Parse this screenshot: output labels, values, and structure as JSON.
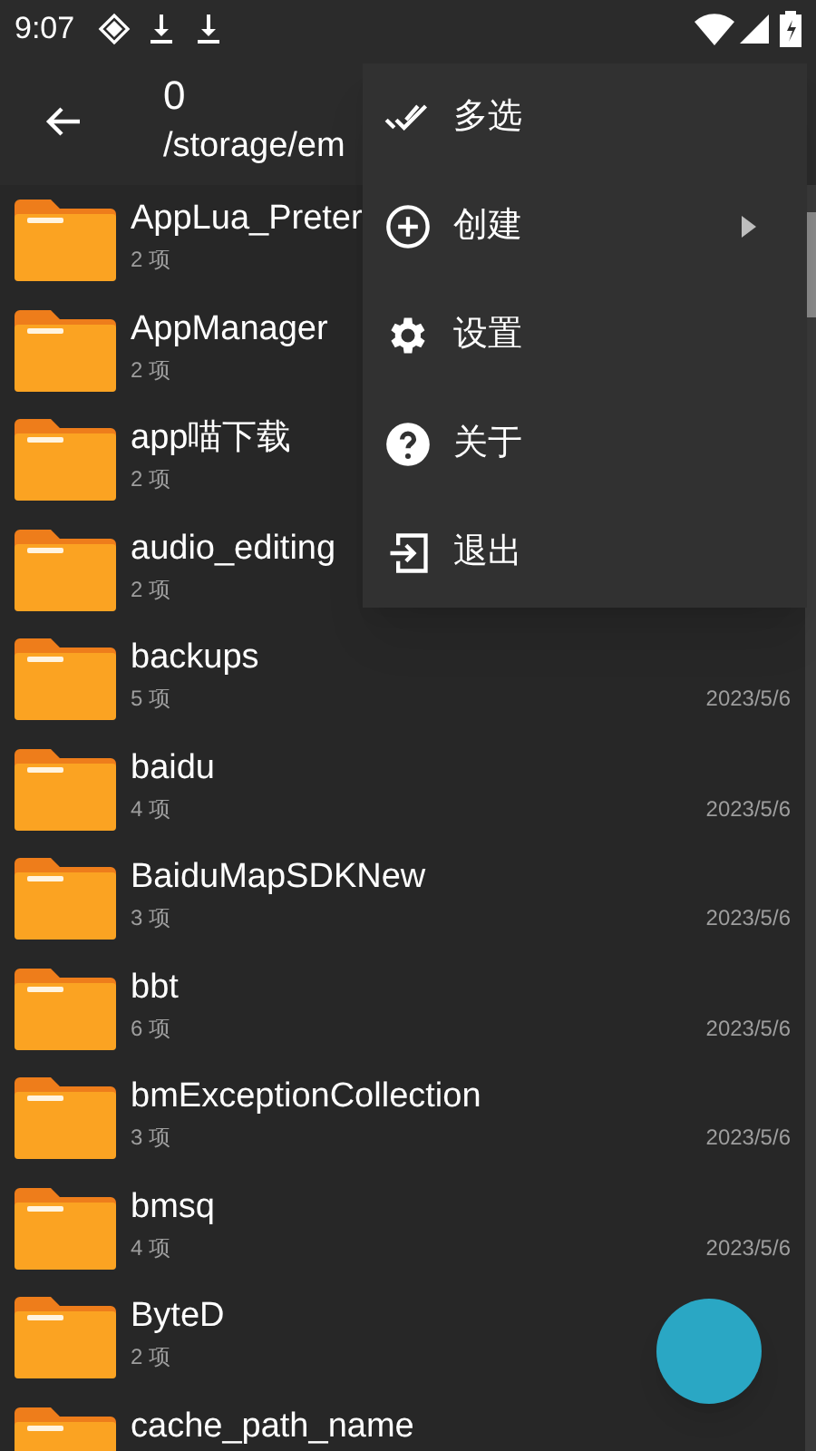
{
  "status_bar": {
    "time": "9:07"
  },
  "app_bar": {
    "title": "0",
    "path": "/storage/em"
  },
  "files": [
    {
      "name": "AppLua_Preter",
      "count": "2 项"
    },
    {
      "name": "AppManager",
      "count": "2 项"
    },
    {
      "name": "app喵下载",
      "count": "2 项"
    },
    {
      "name": "audio_editing",
      "count": "2 项"
    },
    {
      "name": "backups",
      "count": "5 项",
      "date": "2023/5/6"
    },
    {
      "name": "baidu",
      "count": "4 项",
      "date": "2023/5/6"
    },
    {
      "name": "BaiduMapSDKNew",
      "count": "3 项",
      "date": "2023/5/6"
    },
    {
      "name": "bbt",
      "count": "6 项",
      "date": "2023/5/6"
    },
    {
      "name": "bmExceptionCollection",
      "count": "3 项",
      "date": "2023/5/6"
    },
    {
      "name": "bmsq",
      "count": "4 项",
      "date": "2023/5/6"
    },
    {
      "name": "ByteD",
      "count": "2 项"
    },
    {
      "name": "cache_path_name"
    }
  ],
  "menu": [
    {
      "kind": "multiselect",
      "label": "多选",
      "submenu": false
    },
    {
      "kind": "create",
      "label": "创建",
      "submenu": true
    },
    {
      "kind": "settings",
      "label": "设置",
      "submenu": false
    },
    {
      "kind": "about",
      "label": "关于",
      "submenu": false
    },
    {
      "kind": "exit",
      "label": "退出",
      "submenu": false
    }
  ]
}
